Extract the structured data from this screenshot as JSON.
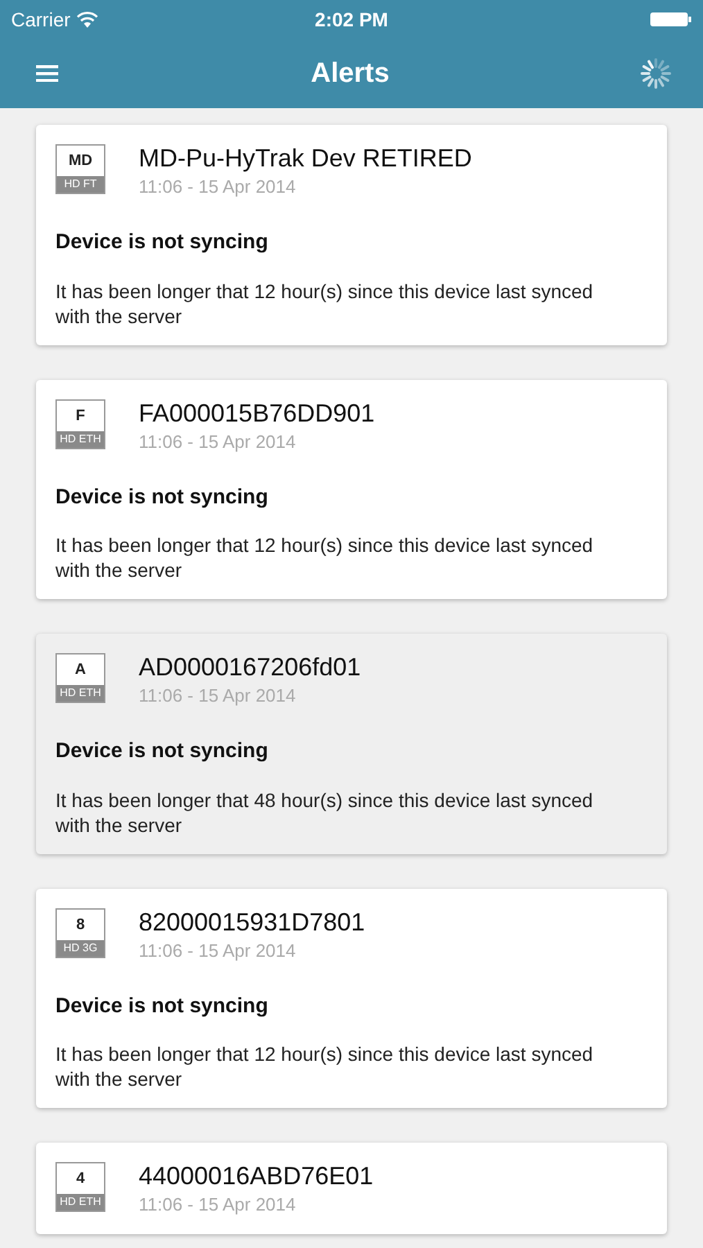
{
  "status_bar": {
    "carrier": "Carrier",
    "time": "2:02 PM"
  },
  "nav": {
    "title": "Alerts",
    "loading": true
  },
  "alerts": [
    {
      "badge_letter": "MD",
      "badge_type": "HD FT",
      "title": "MD-Pu-HyTrak Dev RETIRED",
      "time": "11:06 - 15 Apr 2014",
      "heading": "Device is not syncing",
      "message": "It has been longer that 12 hour(s) since this device last synced with the server",
      "selected": false
    },
    {
      "badge_letter": "F",
      "badge_type": "HD ETH",
      "title": "FA000015B76DD901",
      "time": "11:06 - 15 Apr 2014",
      "heading": "Device is not syncing",
      "message": "It has been longer that 12 hour(s) since this device last synced with the server",
      "selected": false
    },
    {
      "badge_letter": "A",
      "badge_type": "HD ETH",
      "title": "AD0000167206fd01",
      "time": "11:06 - 15 Apr 2014",
      "heading": "Device is not syncing",
      "message": "It has been longer that 48 hour(s) since this device last synced with the server",
      "selected": true
    },
    {
      "badge_letter": "8",
      "badge_type": "HD 3G",
      "title": "82000015931D7801",
      "time": "11:06 - 15 Apr 2014",
      "heading": "Device is not syncing",
      "message": "It has been longer that 12 hour(s) since this device last synced with the server",
      "selected": false
    },
    {
      "badge_letter": "4",
      "badge_type": "HD ETH",
      "title": "44000016ABD76E01",
      "time": "11:06 - 15 Apr 2014",
      "selected": false
    }
  ]
}
